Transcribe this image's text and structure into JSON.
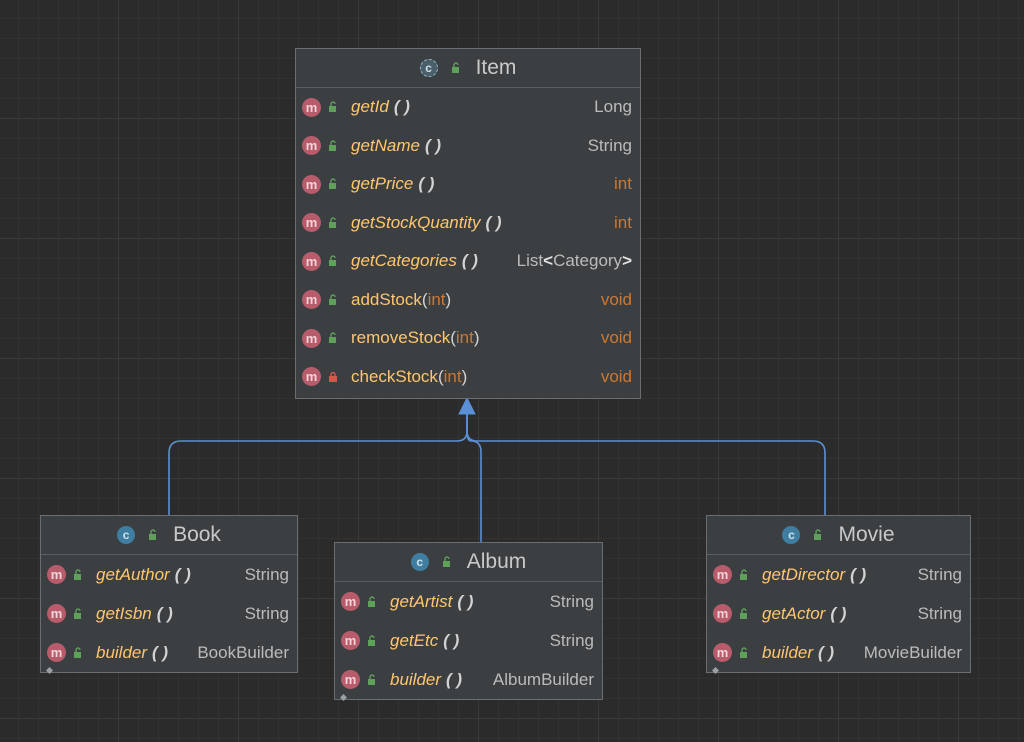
{
  "diagram": {
    "colors": {
      "background": "#2b2b2b",
      "box": "#3c3f41",
      "method_name": "#ffc66d",
      "keyword": "#cc7832",
      "edge": "#5b8fd6",
      "method_icon": "#b85c6b",
      "class_icon": "#3f7ea0"
    },
    "classes": [
      {
        "name": "Item",
        "kind": "abstract-class",
        "members": [
          {
            "name": "getId",
            "params": "( )",
            "returns": "Long",
            "visibility": "public",
            "style": "italic"
          },
          {
            "name": "getName",
            "params": "( )",
            "returns": "String",
            "visibility": "public",
            "style": "italic"
          },
          {
            "name": "getPrice",
            "params": "( )",
            "returns": "int",
            "visibility": "public",
            "style": "italic"
          },
          {
            "name": "getStockQuantity",
            "params": "( )",
            "returns": "int",
            "visibility": "public",
            "style": "italic"
          },
          {
            "name": "getCategories",
            "params": "( )",
            "returns_base": "List",
            "returns_lt": "<",
            "returns_arg": "Category",
            "returns_gt": ">",
            "visibility": "public",
            "style": "italic"
          },
          {
            "name": "addStock",
            "arg": "int",
            "returns": "void",
            "visibility": "public",
            "style": "normal"
          },
          {
            "name": "removeStock",
            "arg": "int",
            "returns": "void",
            "visibility": "public",
            "style": "normal"
          },
          {
            "name": "checkStock",
            "arg": "int",
            "returns": "void",
            "visibility": "private",
            "style": "normal"
          }
        ]
      },
      {
        "name": "Book",
        "kind": "class",
        "members": [
          {
            "name": "getAuthor",
            "params": "( )",
            "returns": "String"
          },
          {
            "name": "getIsbn",
            "params": "( )",
            "returns": "String"
          },
          {
            "name": "builder",
            "params": "( )",
            "returns": "BookBuilder",
            "static": true
          }
        ]
      },
      {
        "name": "Album",
        "kind": "class",
        "members": [
          {
            "name": "getArtist",
            "params": "( )",
            "returns": "String"
          },
          {
            "name": "getEtc",
            "params": "( )",
            "returns": "String"
          },
          {
            "name": "builder",
            "params": "( )",
            "returns": "AlbumBuilder",
            "static": true
          }
        ]
      },
      {
        "name": "Movie",
        "kind": "class",
        "members": [
          {
            "name": "getDirector",
            "params": "( )",
            "returns": "String"
          },
          {
            "name": "getActor",
            "params": "( )",
            "returns": "String"
          },
          {
            "name": "builder",
            "params": "( )",
            "returns": "MovieBuilder",
            "static": true
          }
        ]
      }
    ],
    "edges": [
      {
        "from": "Book",
        "to": "Item",
        "type": "inheritance"
      },
      {
        "from": "Album",
        "to": "Item",
        "type": "inheritance"
      },
      {
        "from": "Movie",
        "to": "Item",
        "type": "inheritance"
      }
    ],
    "icons": {
      "class": "c",
      "method": "m",
      "public": "open-lock-icon",
      "private": "closed-lock-icon",
      "static": "static-marker-icon"
    }
  }
}
